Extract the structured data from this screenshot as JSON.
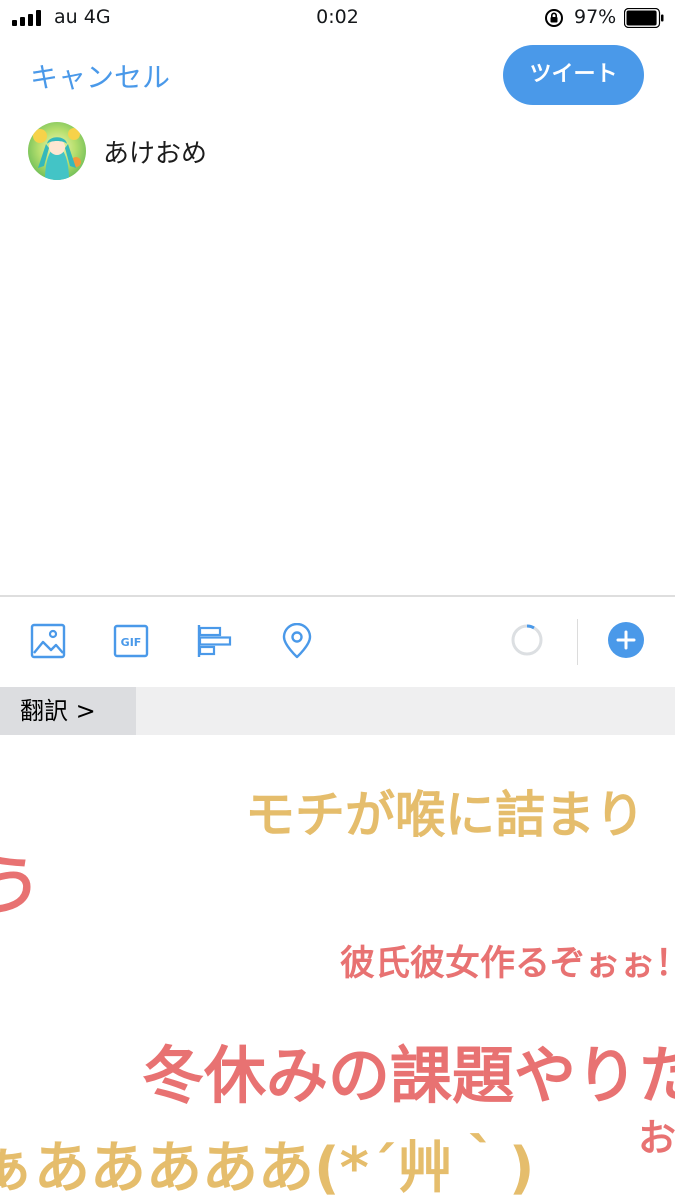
{
  "status_bar": {
    "carrier": "au 4G",
    "time": "0:02",
    "battery_percent": "97%",
    "battery_level": 0.97
  },
  "compose": {
    "cancel_label": "キャンセル",
    "tweet_label": "ツイート",
    "text": "あけおめ"
  },
  "toolbar": {
    "icons": [
      "image-icon",
      "gif-icon",
      "poll-icon",
      "location-icon"
    ],
    "gif_label": "GIF"
  },
  "translate": {
    "label": "翻訳 >"
  },
  "keyboard": {
    "stamps": [
      "モチが喉に詰まり",
      "う",
      "彼氏彼女作るぞぉぉ！",
      "冬休みの課題やりた",
      "お",
      "ぁあああああ(*´艸｀)"
    ]
  },
  "colors": {
    "accent": "#4a99e9",
    "stamp_red": "#e87272",
    "stamp_yellow": "#e5bd6c"
  }
}
